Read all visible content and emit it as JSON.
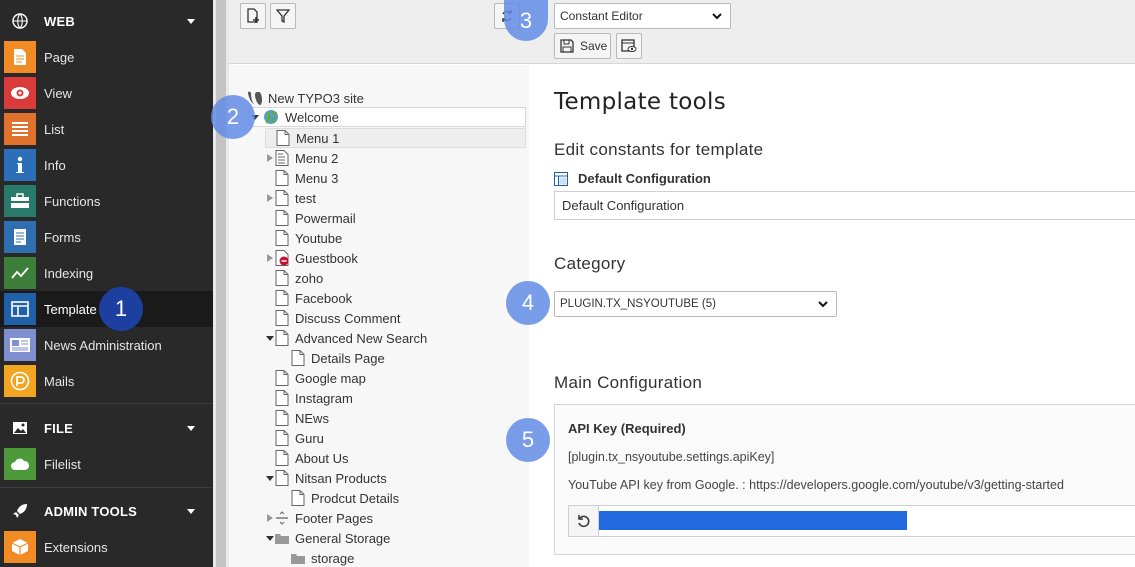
{
  "colors": {
    "accent": "#2369e0",
    "badge": "#6a8fe6",
    "badge_dark": "#1d3fa0",
    "menu_bg": "#292929"
  },
  "sidebar": {
    "groups": [
      {
        "label": "WEB",
        "icon": "globe-icon"
      },
      {
        "label": "FILE",
        "icon": "image-icon"
      },
      {
        "label": "ADMIN TOOLS",
        "icon": "rocket-icon"
      }
    ],
    "web_items": [
      {
        "label": "Page",
        "icon": "page-icon",
        "color": "#f18c25"
      },
      {
        "label": "View",
        "icon": "eye-icon",
        "color": "#d93b3b"
      },
      {
        "label": "List",
        "icon": "list-icon",
        "color": "#e0722d"
      },
      {
        "label": "Info",
        "icon": "info-icon",
        "color": "#2c6fb8"
      },
      {
        "label": "Functions",
        "icon": "toolbox-icon",
        "color": "#2a7a6b"
      },
      {
        "label": "Forms",
        "icon": "form-icon",
        "color": "#2f6fb0"
      },
      {
        "label": "Indexing",
        "icon": "chart-icon",
        "color": "#3d7f3a"
      },
      {
        "label": "Template",
        "icon": "template-icon",
        "color": "#2060a8"
      },
      {
        "label": "News Administration",
        "icon": "news-icon",
        "color": "#7f8fd0"
      },
      {
        "label": "Mails",
        "icon": "mail-icon",
        "color": "#f1a521"
      }
    ],
    "file_items": [
      {
        "label": "Filelist",
        "icon": "folder-cloud-icon",
        "color": "#4c9a3a"
      }
    ],
    "admin_items": [
      {
        "label": "Extensions",
        "icon": "box-icon",
        "color": "#f18c25"
      }
    ]
  },
  "toolbar": {
    "function_select": "Constant Editor",
    "save_label": "Save"
  },
  "tree": {
    "root": "New TYPO3 site",
    "nodes": [
      {
        "label": "Welcome",
        "level": 0
      },
      {
        "label": "Menu 1",
        "level": 1
      },
      {
        "label": "Menu 2",
        "level": 1
      },
      {
        "label": "Menu 3",
        "level": 1
      },
      {
        "label": "test",
        "level": 1
      },
      {
        "label": "Powermail",
        "level": 1
      },
      {
        "label": "Youtube",
        "level": 1
      },
      {
        "label": "Guestbook",
        "level": 1
      },
      {
        "label": "zoho",
        "level": 1
      },
      {
        "label": "Facebook",
        "level": 1
      },
      {
        "label": "Discuss Comment",
        "level": 1
      },
      {
        "label": "Advanced New Search",
        "level": 1
      },
      {
        "label": "Details Page",
        "level": 2
      },
      {
        "label": "Google map",
        "level": 1
      },
      {
        "label": "Instagram",
        "level": 1
      },
      {
        "label": "NEws",
        "level": 1
      },
      {
        "label": "Guru",
        "level": 1
      },
      {
        "label": "About Us",
        "level": 1
      },
      {
        "label": "Nitsan Products",
        "level": 1
      },
      {
        "label": "Prodcut Details",
        "level": 2
      },
      {
        "label": "Footer Pages",
        "level": 1
      },
      {
        "label": "General Storage",
        "level": 1
      },
      {
        "label": "storage",
        "level": 2
      }
    ]
  },
  "content": {
    "title": "Template tools",
    "edit_heading": "Edit constants for template",
    "template_name": "Default Configuration",
    "template_value": "Default Configuration",
    "category_heading": "Category",
    "category_select": "PLUGIN.TX_NSYOUTUBE (5)",
    "main_heading": "Main Configuration",
    "api_title": "API Key (Required)",
    "api_path": "[plugin.tx_nsyoutube.settings.apiKey]",
    "api_desc": "YouTube API key from Google. : https://developers.google.com/youtube/v3/getting-started"
  },
  "badges": [
    "1",
    "2",
    "3",
    "4",
    "5"
  ]
}
